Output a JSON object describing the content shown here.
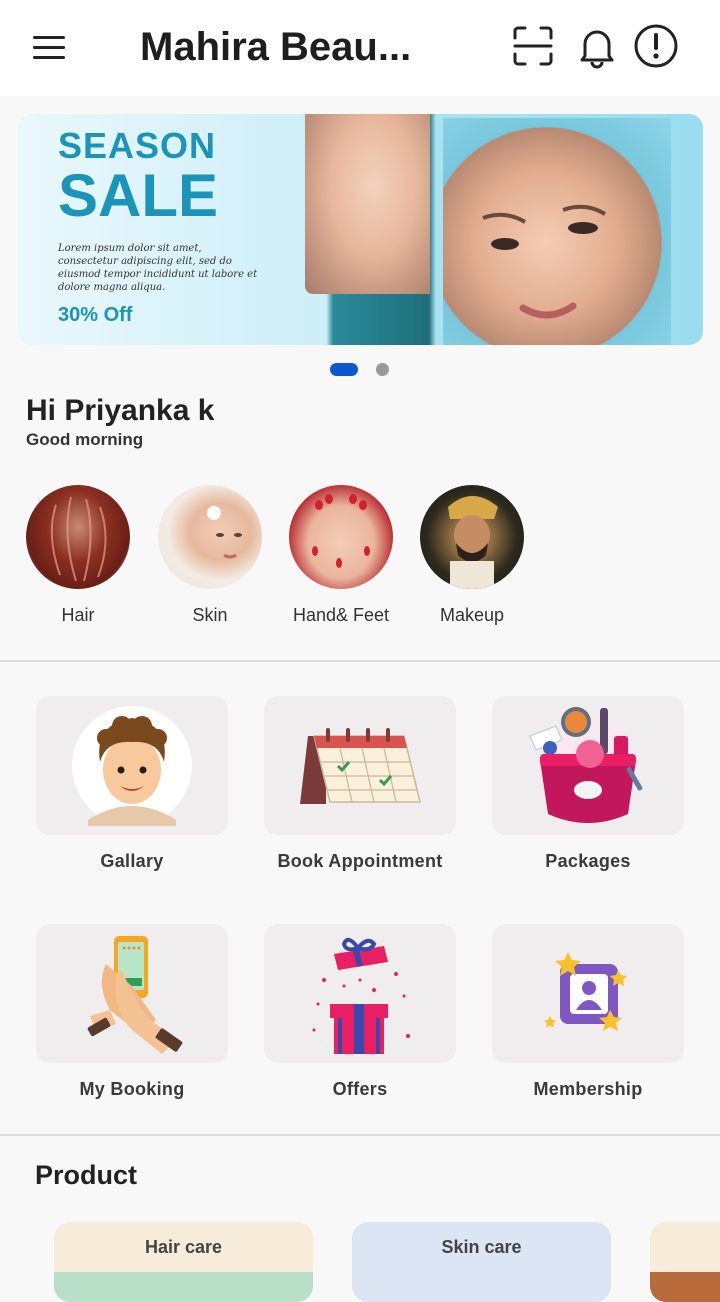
{
  "header": {
    "title": "Mahira Beau...",
    "icons": [
      "menu-icon",
      "scan-icon",
      "bell-icon",
      "info-icon"
    ]
  },
  "banner": {
    "season": "SEASON",
    "sale": "SALE",
    "lorem": "Lorem ipsum dolor sit amet, consectetur adipiscing elit, sed do eiusmod tempor incididunt ut labore et dolore magna aliqua.",
    "offer": "30% Off",
    "active_page": 1,
    "page_count": 2
  },
  "greeting": {
    "name": "Hi Priyanka k",
    "sub": "Good morning"
  },
  "categories": [
    {
      "label": "Hair"
    },
    {
      "label": "Skin"
    },
    {
      "label": "Hand& Feet"
    },
    {
      "label": "Makeup"
    }
  ],
  "tiles": [
    {
      "label": "Gallary"
    },
    {
      "label": "Book Appointment"
    },
    {
      "label": "Packages"
    },
    {
      "label": "My Booking"
    },
    {
      "label": "Offers"
    },
    {
      "label": "Membership"
    }
  ],
  "products": {
    "heading": "Product",
    "items": [
      {
        "label": "Hair care",
        "color": "#f6ecd9"
      },
      {
        "label": "Skin care",
        "color": "#dbe5f3"
      }
    ]
  },
  "colors": {
    "accent": "#0b57d0",
    "banner_text": "#1c94b9"
  }
}
